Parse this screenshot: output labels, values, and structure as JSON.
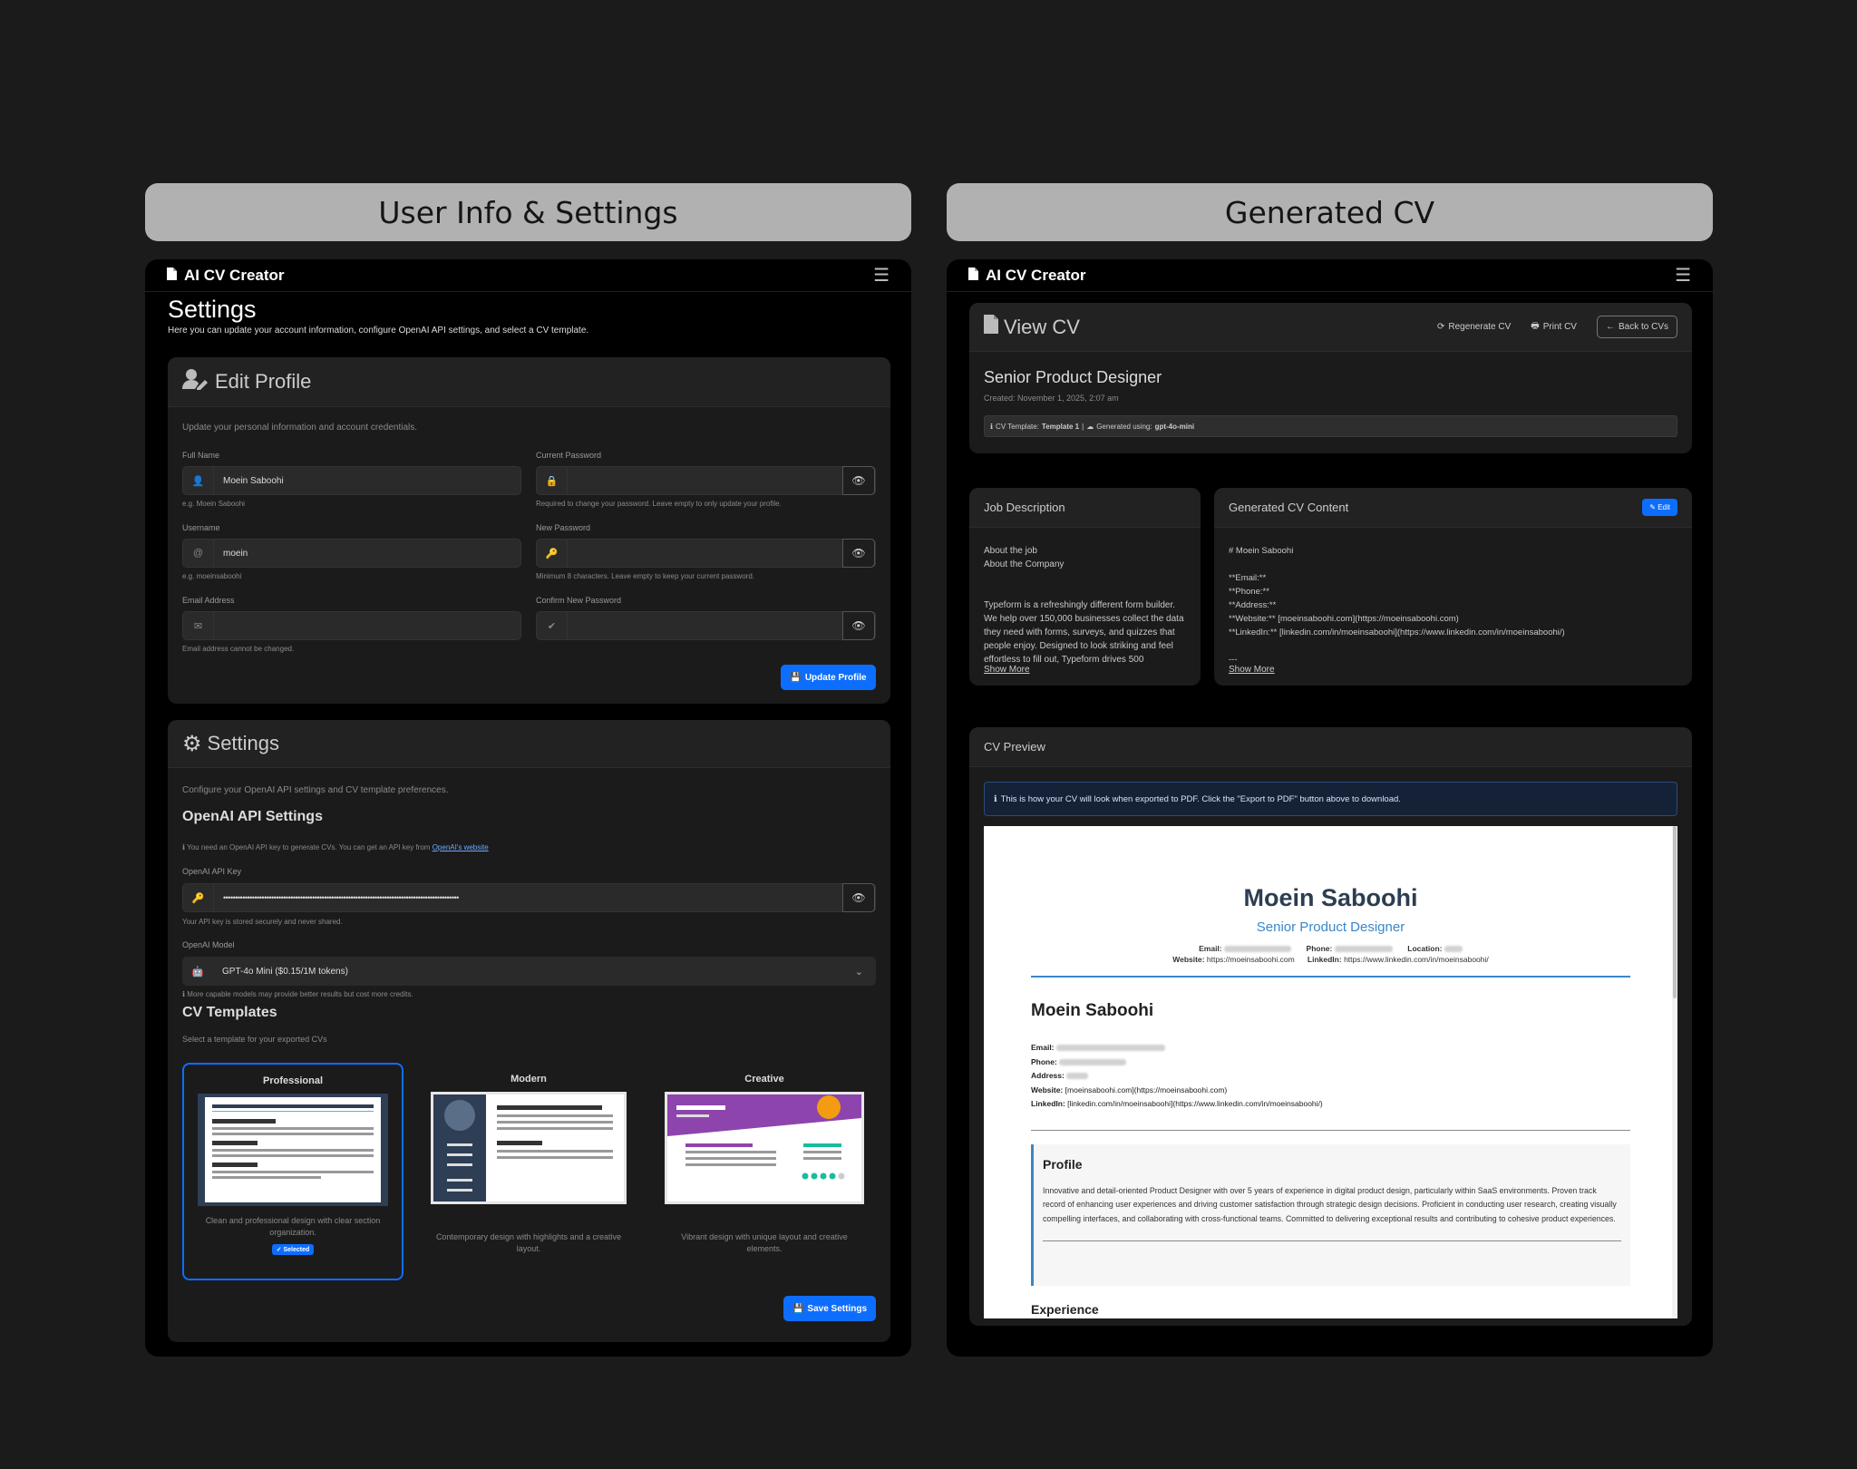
{
  "panels": {
    "left_header": "User Info & Settings",
    "right_header": "Generated CV"
  },
  "app": {
    "brand": "AI CV Creator",
    "menu_icon": "hamburger-icon"
  },
  "settings_page": {
    "title": "Settings",
    "subtitle": "Here you can update your account information, configure OpenAI API settings, and select a CV template.",
    "edit_profile": {
      "title": "Edit Profile",
      "desc": "Update your personal information and account credentials.",
      "full_name_label": "Full Name",
      "full_name_value": "Moein Saboohi",
      "full_name_help": "e.g. Moein Saboohi",
      "username_label": "Username",
      "username_value": "moein",
      "username_help": "e.g. moeinsaboohi",
      "email_label": "Email Address",
      "email_help": "Email address cannot be changed.",
      "current_password_label": "Current Password",
      "current_password_help": "Required to change your password. Leave empty to only update your profile.",
      "new_password_label": "New Password",
      "new_password_help": "Minimum 8 characters. Leave empty to keep your current password.",
      "confirm_password_label": "Confirm New Password",
      "update_button": "Update Profile"
    },
    "settings": {
      "title": "Settings",
      "desc": "Configure your OpenAI API settings and CV template preferences.",
      "api_heading": "OpenAI API Settings",
      "api_info": "You need an OpenAI API key to generate CVs. You can get an API key from",
      "api_link": "OpenAI's website",
      "api_key_label": "OpenAI API Key",
      "api_key_value": "••••••••••••••••••••••••••••••••••••••••••••••••••••••••••••••••••••••••••••••••••••••••••••••••••",
      "api_key_help": "Your API key is stored securely and never shared.",
      "model_label": "OpenAI Model",
      "model_value": "GPT-4o Mini ($0.15/1M tokens)",
      "model_help": "More capable models may provide better results but cost more credits.",
      "templates_heading": "CV Templates",
      "templates_desc": "Select a template for your exported CVs",
      "templates": [
        {
          "name": "Professional",
          "desc": "Clean and professional design with clear section organization.",
          "badge": "Selected"
        },
        {
          "name": "Modern",
          "desc": "Contemporary design with highlights and a creative layout."
        },
        {
          "name": "Creative",
          "desc": "Vibrant design with unique layout and creative elements."
        }
      ],
      "save_button": "Save Settings"
    }
  },
  "view_cv": {
    "title": "View CV",
    "regenerate": "Regenerate CV",
    "print": "Print CV",
    "back": "Back to CVs",
    "job_title": "Senior Product Designer",
    "created": "Created: November 1, 2025, 2:07 am",
    "meta_template_label": "CV Template:",
    "meta_template": "Template 1",
    "meta_model_label": "Generated using:",
    "meta_model": "gpt-4o-mini",
    "job_desc": {
      "title": "Job Description",
      "line1": "About the job",
      "line2": "About the Company",
      "body": "Typeform is a refreshingly different form builder. We help over 150,000 businesses collect the data they need with forms, surveys, and quizzes that people enjoy. Designed to look striking and feel effortless to fill out, Typeform drives 500",
      "show_more": "Show More"
    },
    "generated": {
      "title": "Generated CV Content",
      "edit": "Edit",
      "lines": [
        "# Moein Saboohi",
        "",
        "**Email:**",
        "**Phone:**",
        "**Address:**",
        "**Website:** [moeinsaboohi.com](https://moeinsaboohi.com)",
        "**LinkedIn:** [linkedin.com/in/moeinsaboohi](https://www.linkedin.com/in/moeinsaboohi/)",
        "",
        "---"
      ],
      "show_more": "Show More"
    },
    "preview": {
      "title": "CV Preview",
      "info": "This is how your CV will look when exported to PDF. Click the \"Export to PDF\" button above to download.",
      "name": "Moein Saboohi",
      "role": "Senior Product Designer",
      "email_label": "Email:",
      "phone_label": "Phone:",
      "location_label": "Location:",
      "website_label": "Website:",
      "website": "https://moeinsaboohi.com",
      "linkedin_label": "LinkedIn:",
      "linkedin": "https://www.linkedin.com/in/moeinsaboohi/",
      "h_name": "Moein Saboohi",
      "d_email": "Email:",
      "d_phone": "Phone:",
      "d_address": "Address:",
      "d_website_label": "Website:",
      "d_website": "[moeinsaboohi.com](https://moeinsaboohi.com)",
      "d_linkedin_label": "LinkedIn:",
      "d_linkedin": "[linkedin.com/in/moeinsaboohi](https://www.linkedin.com/in/moeinsaboohi/)",
      "profile_title": "Profile",
      "profile_text": "Innovative and detail-oriented Product Designer with over 5 years of experience in digital product design, particularly within SaaS environments. Proven track record of enhancing user experiences and driving customer satisfaction through strategic design decisions. Proficient in conducting user research, creating visually compelling interfaces, and collaborating with cross-functional teams. Committed to delivering exceptional results and contributing to cohesive product experiences.",
      "next_section": "Experience"
    }
  },
  "colors": {
    "accent": "#0d6efd",
    "cv_blue": "#3a86c8",
    "cv_dark": "#2c3e50"
  }
}
